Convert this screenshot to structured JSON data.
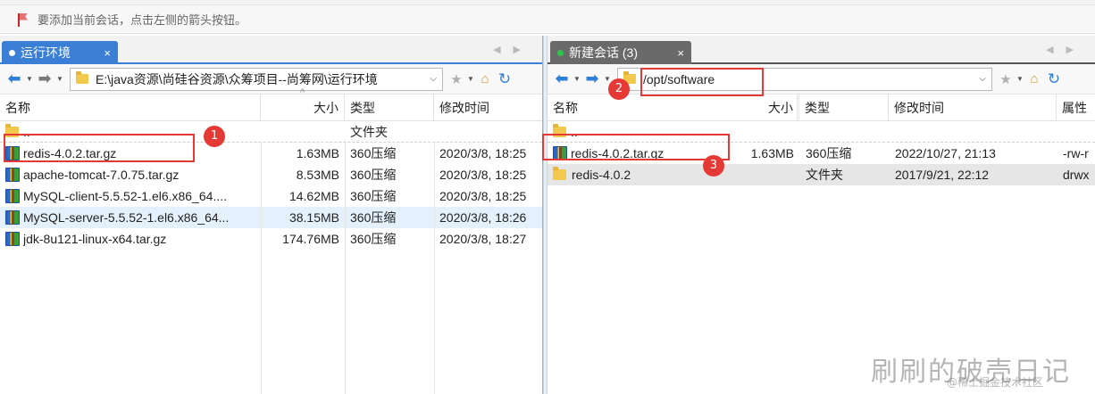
{
  "hint": {
    "text": "要添加当前会话，点击左侧的箭头按钮。"
  },
  "left": {
    "tab": {
      "label": "运行环境",
      "close": "×"
    },
    "path": "E:\\java资源\\尚硅谷资源\\众筹项目--尚筹网\\运行环境",
    "columns": {
      "name": "名称",
      "size": "大小",
      "type": "类型",
      "modified": "修改时间"
    },
    "rows": [
      {
        "name": "..",
        "size": "",
        "type": "文件夹",
        "modified": ""
      },
      {
        "name": "redis-4.0.2.tar.gz",
        "size": "1.63MB",
        "type": "360压缩",
        "modified": "2020/3/8, 18:25"
      },
      {
        "name": "apache-tomcat-7.0.75.tar.gz",
        "size": "8.53MB",
        "type": "360压缩",
        "modified": "2020/3/8, 18:25"
      },
      {
        "name": "MySQL-client-5.5.52-1.el6.x86_64....",
        "size": "14.62MB",
        "type": "360压缩",
        "modified": "2020/3/8, 18:25"
      },
      {
        "name": "MySQL-server-5.5.52-1.el6.x86_64...",
        "size": "38.15MB",
        "type": "360压缩",
        "modified": "2020/3/8, 18:26"
      },
      {
        "name": "jdk-8u121-linux-x64.tar.gz",
        "size": "174.76MB",
        "type": "360压缩",
        "modified": "2020/3/8, 18:27"
      }
    ]
  },
  "right": {
    "tab": {
      "label": "新建会话 (3)",
      "close": "×"
    },
    "path": "/opt/software",
    "columns": {
      "name": "名称",
      "size": "大小",
      "type": "类型",
      "modified": "修改时间",
      "attr": "属性"
    },
    "rows": [
      {
        "name": "..",
        "size": "",
        "type": "",
        "modified": "",
        "attr": ""
      },
      {
        "name": "redis-4.0.2.tar.gz",
        "size": "1.63MB",
        "type": "360压缩",
        "modified": "2022/10/27, 21:13",
        "attr": "-rw-r"
      },
      {
        "name": "redis-4.0.2",
        "size": "",
        "type": "文件夹",
        "modified": "2017/9/21, 22:12",
        "attr": "drwx"
      }
    ]
  },
  "annotations": {
    "badge1": "1",
    "badge2": "2",
    "badge3": "3"
  },
  "watermark": {
    "main": "刷刷的破壳日记",
    "sub": "@稀土掘金技术社区"
  }
}
